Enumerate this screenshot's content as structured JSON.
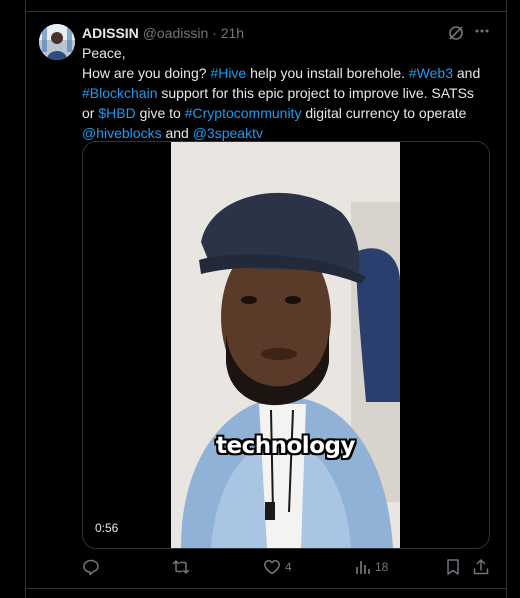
{
  "tweet": {
    "author_name": "ADISSIN",
    "handle": "@oadissin",
    "separator": "·",
    "time": "21h",
    "more_icon": "more-icon",
    "grok_icon": "grok-icon",
    "lines": [
      [
        {
          "t": "Peace,",
          "link": false
        }
      ],
      [
        {
          "t": "How are you doing? ",
          "link": false
        },
        {
          "t": "#Hive",
          "link": true
        },
        {
          "t": " help you install borehole. ",
          "link": false
        },
        {
          "t": "#Web3",
          "link": true
        },
        {
          "t": " and",
          "link": false
        }
      ],
      [
        {
          "t": "#Blockchain",
          "link": true
        },
        {
          "t": " support for this epic project to improve live. SATSs",
          "link": false
        }
      ],
      [
        {
          "t": "or ",
          "link": false
        },
        {
          "t": "$HBD",
          "link": true
        },
        {
          "t": " give to ",
          "link": false
        },
        {
          "t": "#Cryptocommunity",
          "link": true
        },
        {
          "t": " digital currency to operate",
          "link": false
        }
      ],
      [
        {
          "t": "@hiveblocks",
          "link": true
        },
        {
          "t": " and ",
          "link": false
        },
        {
          "t": "@3speaktv",
          "link": true
        }
      ]
    ]
  },
  "media": {
    "caption": "technology",
    "duration": "0:56"
  },
  "actions": {
    "reply_count": "",
    "retweet_count": "",
    "like_count": "4",
    "views_count": "18"
  },
  "colors": {
    "background": "#000000",
    "text": "#e7e9ea",
    "muted": "#71767b",
    "link": "#1d9bf0",
    "border": "#2f3336"
  }
}
